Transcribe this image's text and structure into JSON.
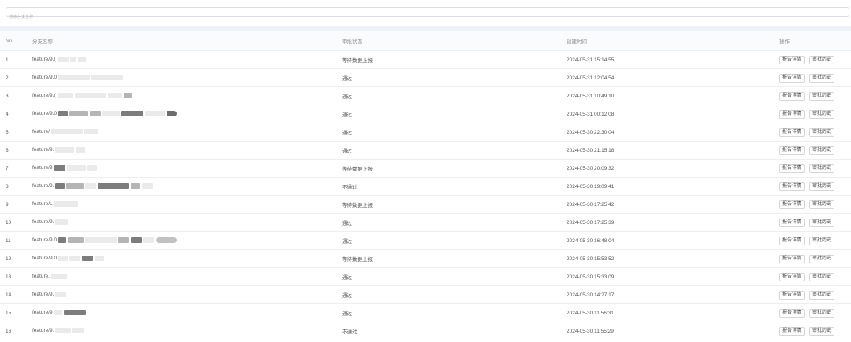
{
  "search": {
    "placeholder": "搜索分支名称"
  },
  "table": {
    "headers": {
      "no": "No",
      "name": "分支名称",
      "status": "审批状态",
      "time": "创建时间",
      "ops": "操作"
    },
    "op_labels": {
      "report": "报告详情",
      "history": "审批历史"
    },
    "rows": [
      {
        "no": "1",
        "name": "feature/9.(",
        "status": "等待数据上报",
        "time": "2024-05-31 15:14:55"
      },
      {
        "no": "2",
        "name": "feature/9.0",
        "status": "通过",
        "time": "2024-05-31 12:04:54"
      },
      {
        "no": "3",
        "name": "feature/9.(",
        "status": "通过",
        "time": "2024-05-31 10:49:10"
      },
      {
        "no": "4",
        "name": "feature/9.0",
        "status": "通过",
        "time": "2024-05-31 00:12:08"
      },
      {
        "no": "5",
        "name": "feature/",
        "status": "通过",
        "time": "2024-05-30 22:30:04"
      },
      {
        "no": "6",
        "name": "feature/9.",
        "status": "通过",
        "time": "2024-05-30 21:15:18"
      },
      {
        "no": "7",
        "name": "feature/9",
        "status": "等待数据上报",
        "time": "2024-05-30 20:09:32"
      },
      {
        "no": "8",
        "name": "feature/9.",
        "status": "不通过",
        "time": "2024-05-30 19:09:41"
      },
      {
        "no": "9",
        "name": "feature/L",
        "status": "等待数据上报",
        "time": "2024-05-30 17:25:42"
      },
      {
        "no": "10",
        "name": "feature/9.",
        "status": "通过",
        "time": "2024-05-30 17:25:39"
      },
      {
        "no": "11",
        "name": "feature/9.0",
        "status": "通过",
        "time": "2024-05-30 16:48:04"
      },
      {
        "no": "12",
        "name": "feature/9.0",
        "status": "等待数据上报",
        "time": "2024-05-30 15:53:52"
      },
      {
        "no": "13",
        "name": "feature,",
        "status": "通过",
        "time": "2024-05-30 15:33:09"
      },
      {
        "no": "14",
        "name": "feature/9.",
        "status": "通过",
        "time": "2024-05-30 14:27:17"
      },
      {
        "no": "15",
        "name": "feature/9",
        "status": "通过",
        "time": "2024-05-30 11:56:31"
      },
      {
        "no": "16",
        "name": "feature/9.",
        "status": "不通过",
        "time": "2024-05-30 11:55:29"
      }
    ]
  }
}
